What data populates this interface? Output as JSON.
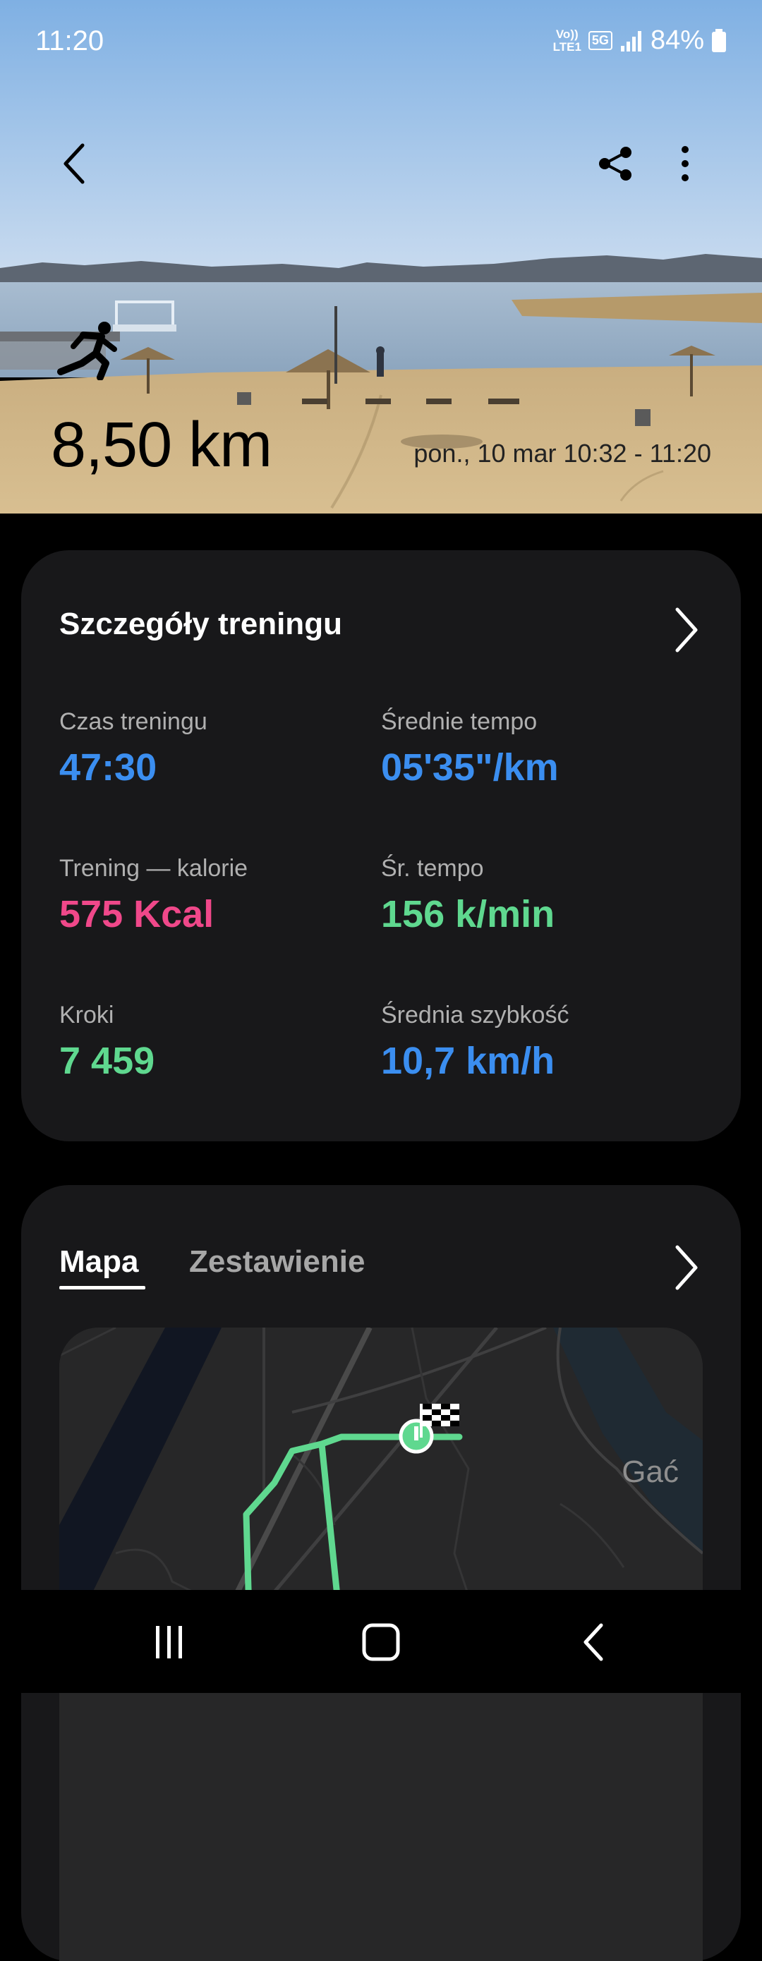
{
  "status_bar": {
    "time": "11:20",
    "network_label_1": "Vo))",
    "network_label_2": "LTE1",
    "badge_5g": "5G",
    "battery": "84%"
  },
  "header": {
    "icons": [
      "back-arrow-icon",
      "share-icon",
      "more-vert-icon"
    ],
    "distance": "8,50 km",
    "date_range": "pon., 10 mar 10:32 - 11:20",
    "activity_icon": "running-icon"
  },
  "details_card": {
    "title": "Szczegóły treningu",
    "stats": [
      {
        "label": "Czas treningu",
        "value": "47:30",
        "color": "#3b8ef0"
      },
      {
        "label": "Średnie tempo",
        "value": "05'35\"/km",
        "color": "#3b8ef0"
      },
      {
        "label": "Trening — kalorie",
        "value": "575 Kcal",
        "color": "#f0488a"
      },
      {
        "label": "Śr. tempo",
        "value": "156 k/min",
        "color": "#5fd88f"
      },
      {
        "label": "Kroki",
        "value": "7 459",
        "color": "#5fd88f"
      },
      {
        "label": "Średnia szybkość",
        "value": "10,7 km/h",
        "color": "#3b8ef0"
      }
    ]
  },
  "map_card": {
    "tabs": [
      {
        "label": "Mapa",
        "active": true
      },
      {
        "label": "Zestawienie",
        "active": false
      }
    ],
    "map_label": "Gać",
    "route_color": "#5fd88f"
  },
  "nav_bar": {
    "buttons": [
      "recents-icon",
      "home-icon",
      "back-icon"
    ]
  }
}
